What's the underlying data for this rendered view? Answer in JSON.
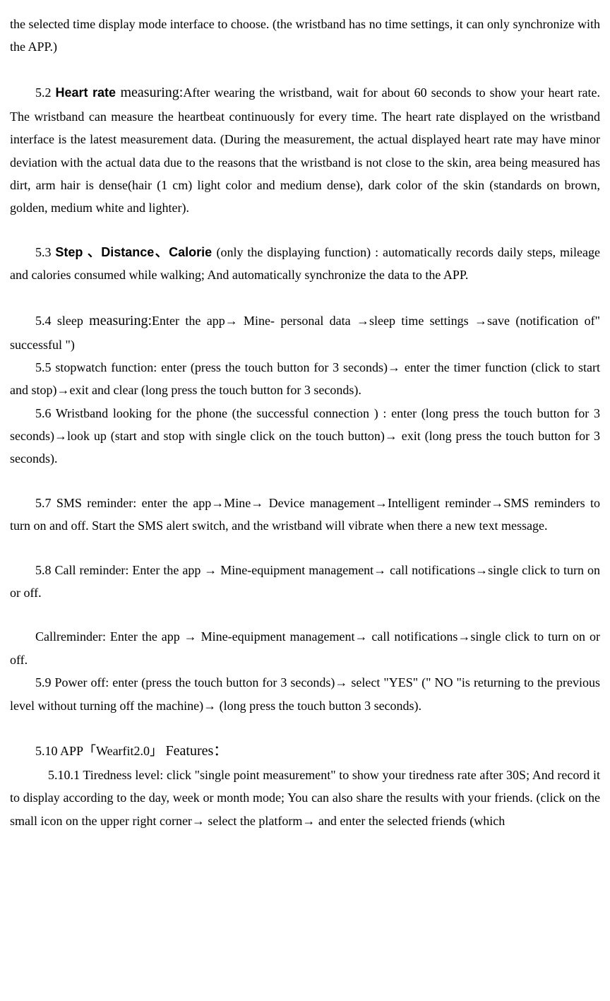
{
  "p1": "the selected time display mode interface to choose. (the wristband has no time settings, it can only synchronize with the APP.)",
  "s52_num": "5.2  ",
  "s52_bold": "Heart rate ",
  "s52_word": "measuring:",
  "s52_body": "After wearing the wristband, wait for about 60 seconds to show your heart rate. The wristband can measure the heartbeat continuously for every time. The heart rate displayed on the wristband interface is the latest measurement data. (During the measurement, the actual displayed heart rate may have minor deviation with the actual data due to the reasons that the wristband is not close to the skin, area being measured has dirt, arm hair is dense(hair (1 cm) light color and medium dense), dark color of the skin (standards on brown, golden, medium white and lighter).",
  "s53_num": "5.3 ",
  "s53_bold": "Step 、Distance、Calorie ",
  "s53_body": "(only the displaying function) : automatically records daily steps, mileage and calories consumed while walking; And automatically synchronize the data to the APP.",
  "s54_num": "5.4 sleep ",
  "s54_word": "measuring:",
  "s54_body": "Enter the app→ Mine- personal data →sleep time settings →save (notification of\" successful \")",
  "s55": "5.5 stopwatch function: enter (press the touch button for 3 seconds)→ enter the timer function (click to start and stop)→exit and clear (long press the touch button for 3 seconds).",
  "s56": "5.6  Wristband looking for the phone (the  successful connection ) : enter (long press the touch button for 3 seconds)→look up (start and stop with single click on the touch button)→ exit (long press the touch button for 3 seconds).",
  "s57": "5.7  SMS reminder: enter the app→Mine→ Device management→Intelligent reminder→SMS reminders to turn on and off. Start the SMS alert switch, and the wristband will vibrate when there a new text message.",
  "s58": "5.8  Call  reminder:  Enter  the  app  →  Mine-equipment  management→  call notifications→single click to turn on or off.",
  "s58b": "Callreminder:   Enter   the   app   →   Mine-equipment   management→   call notifications→single click to turn on or off.",
  "s59": "5.9  Power off: enter (press the touch button for 3 seconds)→ select \"YES\" (\" NO \"is returning to the previous level without turning off the machine)→ (long press the touch button 3 seconds).",
  "s510_num": "5.10  APP「Wearfit2.0」 ",
  "s510_word": "Features：",
  "s5101": "5.10.1 Tiredness level: click \"single point measurement\" to show your tiredness rate after 30S; And record it to display according to the day, week or month mode; You can also share the results with your friends. (click on the small icon on the upper right corner→ select the platform→ and enter the selected friends (which"
}
